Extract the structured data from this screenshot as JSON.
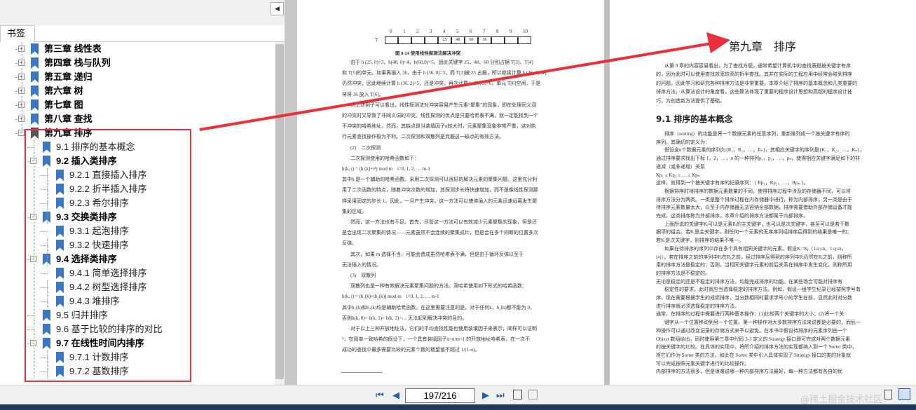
{
  "panel": {
    "tab": "书签",
    "collapse_icon": "◀"
  },
  "bookmarks": [
    {
      "label": "第三章 线性表",
      "bold": true,
      "level": 0,
      "expander": "+"
    },
    {
      "label": "第四章 栈与队列",
      "bold": true,
      "level": 0,
      "expander": "+"
    },
    {
      "label": "第五章 递归",
      "bold": true,
      "level": 0,
      "expander": "+"
    },
    {
      "label": "第六章 树",
      "bold": true,
      "level": 0,
      "expander": "+"
    },
    {
      "label": "第七章 图",
      "bold": true,
      "level": 0,
      "expander": "+"
    },
    {
      "label": "第八章 查找",
      "bold": true,
      "level": 0,
      "expander": "+"
    },
    {
      "label": "第九章 排序",
      "bold": true,
      "level": 0,
      "expander": "−"
    },
    {
      "label": "9.1 排序的基本概念",
      "bold": false,
      "level": 1,
      "expander": ""
    },
    {
      "label": "9.2 插入类排序",
      "bold": true,
      "level": 1,
      "expander": "−"
    },
    {
      "label": "9.2.1 直接插入排序",
      "bold": false,
      "level": 2,
      "expander": ""
    },
    {
      "label": "9.2.2 折半插入排序",
      "bold": false,
      "level": 2,
      "expander": ""
    },
    {
      "label": "9.2.3 希尔排序",
      "bold": false,
      "level": 2,
      "expander": ""
    },
    {
      "label": "9.3 交换类排序",
      "bold": true,
      "level": 1,
      "expander": "−"
    },
    {
      "label": "9.3.1 起泡排序",
      "bold": false,
      "level": 2,
      "expander": ""
    },
    {
      "label": "9.3.2 快速排序",
      "bold": false,
      "level": 2,
      "expander": ""
    },
    {
      "label": "9.4 选择类排序",
      "bold": true,
      "level": 1,
      "expander": "−"
    },
    {
      "label": "9.4.1 简单选择排序",
      "bold": false,
      "level": 2,
      "expander": ""
    },
    {
      "label": "9.4.2 树型选择排序",
      "bold": false,
      "level": 2,
      "expander": ""
    },
    {
      "label": "9.4.3 堆排序",
      "bold": false,
      "level": 2,
      "expander": ""
    },
    {
      "label": "9.5 归并排序",
      "bold": false,
      "level": 1,
      "expander": ""
    },
    {
      "label": "9.6 基于比较的排序的对比",
      "bold": false,
      "level": 1,
      "expander": ""
    },
    {
      "label": "9.7 在线性时间内排序",
      "bold": true,
      "level": 1,
      "expander": "−"
    },
    {
      "label": "9.7.1 计数排序",
      "bold": false,
      "level": 2,
      "expander": ""
    },
    {
      "label": "9.7.2 基数排序",
      "bold": false,
      "level": 2,
      "expander": ""
    }
  ],
  "left_page": {
    "table_indices": [
      "0",
      "1",
      "2",
      "3",
      "4",
      "5",
      "6",
      "7",
      "8",
      "9",
      "10"
    ],
    "table_row_label": "T",
    "table_values": [
      "",
      "",
      "",
      "",
      "25",
      "48",
      "60",
      "36",
      "",
      "",
      ""
    ],
    "figure_caption": "图 8-24 使用线性探测法解决冲突",
    "body": [
      "由于 h (25, 0)=3，h(48, 0)=4，h(60,0)=5，因此关键字 25、48、60 分别占据 T[3]、T[4]",
      "和 T[5]的单元。如果再插入 36，由于 h (36, 0)=3，而 T[3]被 25 占据，所以继续计算 h (36, 1)=4，",
      "仍然冲突，因此继续计算 h (36, 2)=5，还是冲突，再次计算 h (36, 3)=6，单元 T[6]空闲，于是",
      "将将 36 放入 T[6]。",
      "从上述例子可以看出，线性探测法对冲突容易产生元素“聚集”的现象，即在处理同义词",
      "的冲突时又导致了非同义词的冲突。线性探测的优点是只要哈希表不满，就一定能找到一个",
      "不冲突的哈希地址，然而，其缺点是当装填因子α较大时，元素聚集现象非常严重，这对执",
      "行元素查找操作极为不利。二次探测和双散列是克服这一缺点的有效方法。",
      "(2)　二次探测",
      "二次探测使用的哈希函数如下：",
      "h(k, i) = (h (k)+i²) mod m　i=0, 1, 2, … m-1",
      "其中h 是一个辅助的哈希函数。采用二次探测可以很好的解决元素的聚集问题。这里充分利",
      "用了二次函数的特点，随着冲突次数的增加，其探测步长将快速增加，而不是像线性探测那",
      "样采用固定的步长 1。因此，一旦产生冲突，这一方法可以使待插入的元素迅速远离发生聚",
      "集的区域。",
      "然而，这一方法也有不足。首先，尽管这一方法可以有效减少元素聚集的现象，但是还",
      "是会出现二次聚集的情况——元素虽然不会连续的聚集成片，但是会在多个间断的位置多次",
      "反弹。",
      "其次，如果 m 选择不当，可能会造成虽然哈希表不满，但是由于循环反弹以至于",
      "无法插入的情况。",
      "(3)　双散列",
      "双散列也是一种有效解决元素聚集问题的方法。双哈希使用如下形式的哈希函数：",
      "h(k, i) = (h₁(k)+ih₂(k)) mod m　i=0, 1, 2, … m-1",
      "其中h₁(k)和h₂(k)均是辅助哈希函数。在这里需要注意的是，对于任何k，h₂(k)都不能为 0，",
      "否则h(k, 0)= h(k, 1)= h(k, 2)=… 无法起到解决冲突的目的。",
      "对于以上三种开放地址法，它们的平均查找性能也使用装填因子来表示，同样可以证明",
      "⁵，在简单一致哈希的假设下，一个具有装填因子α=n/m<1 的开放地址哈希表，在一次不",
      "成功的查找中最多需要比较的元素个数的期望值不超过 1/(1-α)。"
    ]
  },
  "right_page": {
    "chapter_title": "第九章　排序",
    "intro": [
      "从第 9 章的内容容易看出，为了查找方便，通常希望计算机中的查找表是按关键字有序",
      "的，因为此时可以使用查找效率较高的折半查找。其并在实际的工程应用中经常会碰到排序",
      "的问题，因此学习和研究各种排序方法是非常重要。本章介绍了排序的基本概念和几类重要的",
      "排序方法，从算法设计的角度看，这些算法体现了重要的程序设计思想和高超的程序设计技",
      "巧，为创造新方法提供了基础。"
    ],
    "section_title": "9.1 排序的基本概念",
    "body": [
      "排序（sorting）的功能是将一个数据元素的任意序列，重新排列成一个按关键字有序的",
      "序列。其确切的定义为：",
      "假设含n个数据元素的序列为{R₁，R₂，…，Rₙ}，其相应关键字的序列是{K₁，K₂，…，Kₙ}，",
      "通过排序要求找出下标 1，2，…，n 的一种排列p₁，p₂，…，pₙ，使得相应关键字满足如下的非",
      "递减（或非递增）关系",
      "Kp₁ ≤ Kp₂ ≤ … ≤ Kpₙ",
      "这样，就得到一个按关键字有序的纪录序列：{ Rp₁，Rp₂，…，Rpₙ }。",
      "根据排序时待排序的数据元素数量的不同，使得排序过程中涉及的存储器不同，可以将",
      "排序方法分为两类。一类是整个排序过程在内存储器中进行，称为内部排序；另一类是由于",
      "待排序元素数量太大，以至于内存储器无法容纳全部数据，排序需要借助外部存储设备才能",
      "完成，这类排序称为外部排序。本章介绍的排序方法都属于内部排序。",
      "上面所说的关键字Kᵢ可以是元素Rᵢ的主关键字，也可以是次关键字，甚至可以是若干数",
      "据项的组合。若Kᵢ是主关键字，则任何一个元素的无序序列经排序后得到的结果是唯一的；",
      "若Kᵢ是次关键字，则排序的结果不唯一。",
      "如果在待排序的序列中存在多个具有相同关键字的元素。假设Kᵢ=Kⱼ（1≤i≤n，1≤j≤n，",
      "i≠j），若在排序之前的序列中Rᵢ在Rⱼ之前，经过排序后得到的序列中Rᵢ仍然在Rⱼ之前，则称所",
      "用的排序方法是稳定的；否则，当相同关键字元素的前后关系在排序中发生变化，则称所用",
      "的排序方法是不稳定的。",
      "无论是稳定的还是不稳定的排序方法，均能完成排序的功能。在某些场合可能对排序有",
      "稳定性的要求，此时就应当选择稳定的排序方法。例如，假设一组学生纪录已经按照学号有",
      "序，现在需要根据学生的成绩排序，当分数相同时要求学号小的学生在前，显然此时对分数",
      "进行排序就必须选择稳定的排序方法。",
      "通常，在排序的过程中需要进行两种基本操作：(1)比较两个关键字的大小；(2)将一个关",
      "键字从一个位置移动到另一个位置。第一种操作对大多数排序方法来说都是必要的，而后一",
      "种操作可以通过改变记录的存储方式来予以避免。在本书中假设待排序的元素序列由一个",
      "Object 数组给出，同时使用第三章中代码 3-3 定义的 Strategy 接口即可完成对两个数据元素",
      "的按关键字的比较。在具体的实现中，将所介绍的排序方法的实现都纳入到一个 Sorter 类中，",
      "将它们作为 Sorter 类的方法，如此在 Sorter 类中引入具体实现了 Strategy 接口的类的对象就",
      "可以完成按照元素关键字进行的比较操作。",
      "内部排序的方法很多，但是很难说哪一种内部排序方法最好，每一种方法都有各自的优"
    ]
  },
  "navigation": {
    "first_icon": "⏮",
    "prev_icon": "◀",
    "next_icon": "▶",
    "last_icon": "⏭",
    "page_value": "197/216"
  },
  "watermark": "@稀土掘金技术社区",
  "colors": {
    "annotation": "#e8313c",
    "bookmark": "#3a78c2",
    "viewer_bg": "#bfbfbf"
  }
}
